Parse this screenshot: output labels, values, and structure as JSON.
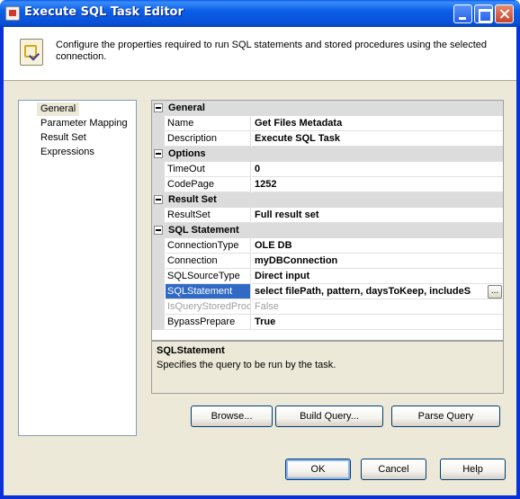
{
  "window": {
    "title": "Execute SQL Task Editor"
  },
  "header": {
    "text": "Configure the properties required to run SQL statements and stored procedures using the selected connection."
  },
  "nav": {
    "items": [
      {
        "label": "General"
      },
      {
        "label": "Parameter Mapping"
      },
      {
        "label": "Result Set"
      },
      {
        "label": "Expressions"
      }
    ],
    "selected": "General"
  },
  "grid": {
    "categories": {
      "general": "General",
      "options": "Options",
      "result_set": "Result Set",
      "sql_statement": "SQL Statement"
    },
    "props": {
      "name": {
        "label": "Name",
        "value": "Get Files Metadata"
      },
      "description": {
        "label": "Description",
        "value": "Execute SQL Task"
      },
      "timeout": {
        "label": "TimeOut",
        "value": "0"
      },
      "codepage": {
        "label": "CodePage",
        "value": "1252"
      },
      "resultset": {
        "label": "ResultSet",
        "value": "Full result set"
      },
      "connectiontype": {
        "label": "ConnectionType",
        "value": "OLE DB"
      },
      "connection": {
        "label": "Connection",
        "value": "myDBConnection"
      },
      "sqlsourcetype": {
        "label": "SQLSourceType",
        "value": "Direct input"
      },
      "sqlstatement": {
        "label": "SQLStatement",
        "value": "select filePath, pattern, daysToKeep, includeS"
      },
      "isquerystoredproc": {
        "label": "IsQueryStoredProc",
        "value": "False"
      },
      "bypassprepare": {
        "label": "BypassPrepare",
        "value": "True"
      }
    },
    "ellipsis": "..."
  },
  "description_panel": {
    "title": "SQLStatement",
    "text": "Specifies the query to be run by the task."
  },
  "buttons": {
    "browse": "Browse...",
    "build_query": "Build Query...",
    "parse_query": "Parse Query",
    "ok": "OK",
    "cancel": "Cancel",
    "help": "Help"
  },
  "colors": {
    "titlebar": "#0a5bf0",
    "selection": "#316ac5",
    "dialog_bg": "#ece9d8"
  }
}
